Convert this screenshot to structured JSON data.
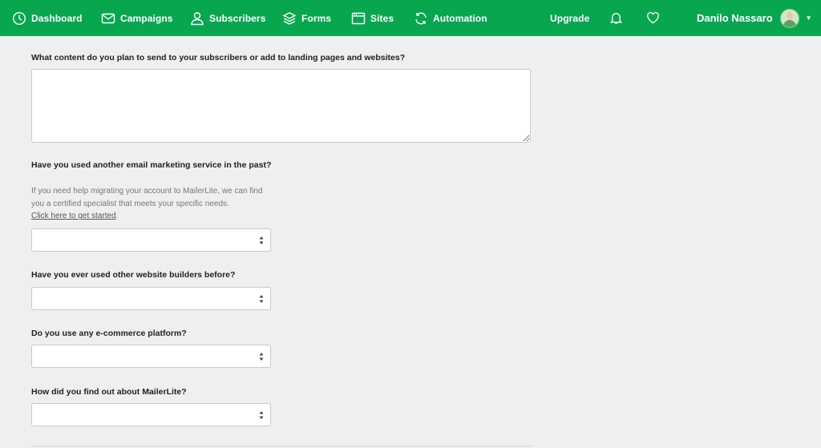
{
  "nav": {
    "items": [
      {
        "label": "Dashboard",
        "icon": "dashboard-icon"
      },
      {
        "label": "Campaigns",
        "icon": "envelope-icon"
      },
      {
        "label": "Subscribers",
        "icon": "user-icon"
      },
      {
        "label": "Forms",
        "icon": "layers-icon"
      },
      {
        "label": "Sites",
        "icon": "browser-window-icon"
      },
      {
        "label": "Automation",
        "icon": "refresh-icon"
      }
    ],
    "upgrade_label": "Upgrade",
    "user_name": "Danilo Nassaro"
  },
  "colors": {
    "header": "#09a650",
    "background": "#efefef",
    "field_border": "#c9c9c9"
  },
  "form": {
    "q_content": {
      "label": "What content do you plan to send to your subscribers or add to landing pages and websites?",
      "value": ""
    },
    "q_email_service": {
      "label": "Have you used another email marketing service in the past?",
      "help_text": "If you need help migrating your account to MailerLite, we can find you a certified specialist that meets your specific needs.",
      "help_link": "Click here to get started",
      "value": ""
    },
    "q_website_builders": {
      "label": "Have you ever used other website builders before?",
      "value": ""
    },
    "q_ecommerce": {
      "label": "Do you use any e-commerce platform?",
      "value": ""
    },
    "q_source": {
      "label": "How did you find out about MailerLite?",
      "value": ""
    }
  }
}
